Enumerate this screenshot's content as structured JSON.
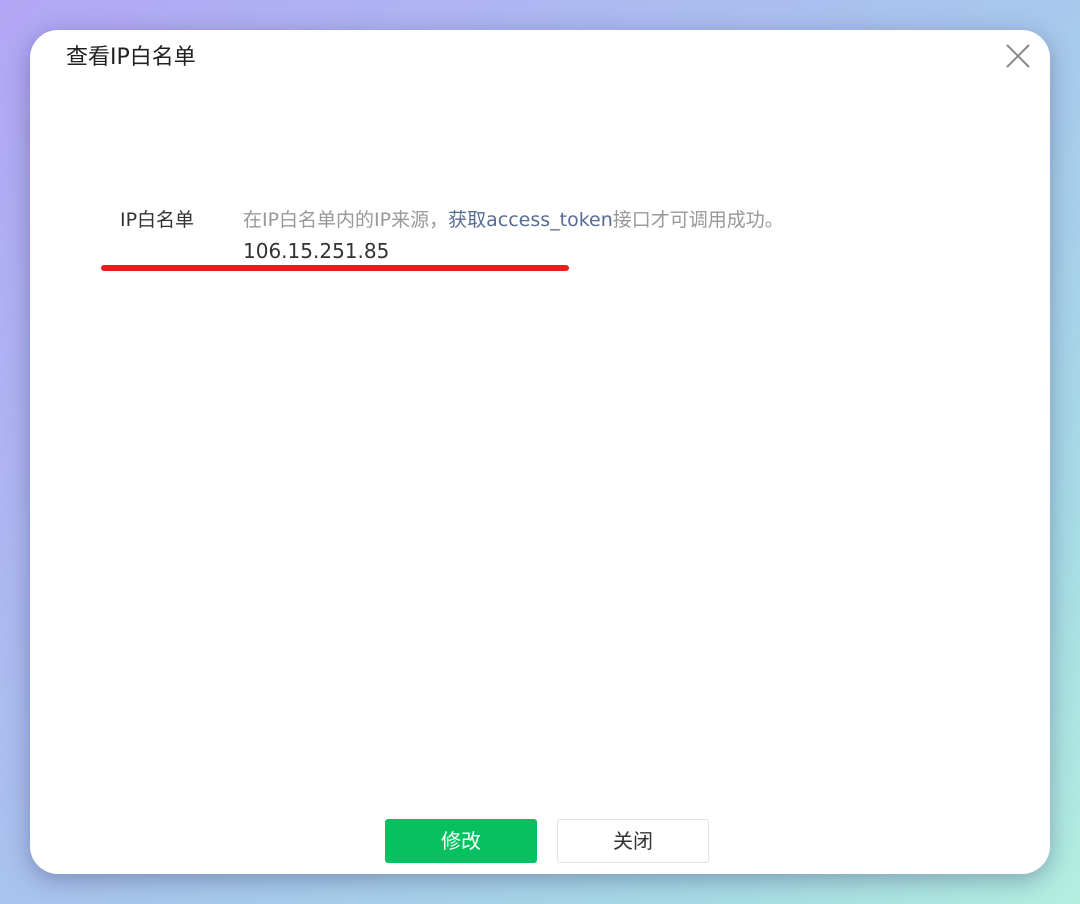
{
  "dialog": {
    "title": "查看IP白名单",
    "close_icon": "close-icon"
  },
  "field": {
    "label": "IP白名单",
    "desc_prefix": "在IP白名单内的IP来源，",
    "desc_link": "获取access_token",
    "desc_suffix": "接口才可调用成功。",
    "ip_value": "106.15.251.85"
  },
  "footer": {
    "modify_label": "修改",
    "close_label": "关闭"
  },
  "colors": {
    "primary": "#07c160",
    "link": "#576b95",
    "annotation": "#ee1c1c"
  }
}
